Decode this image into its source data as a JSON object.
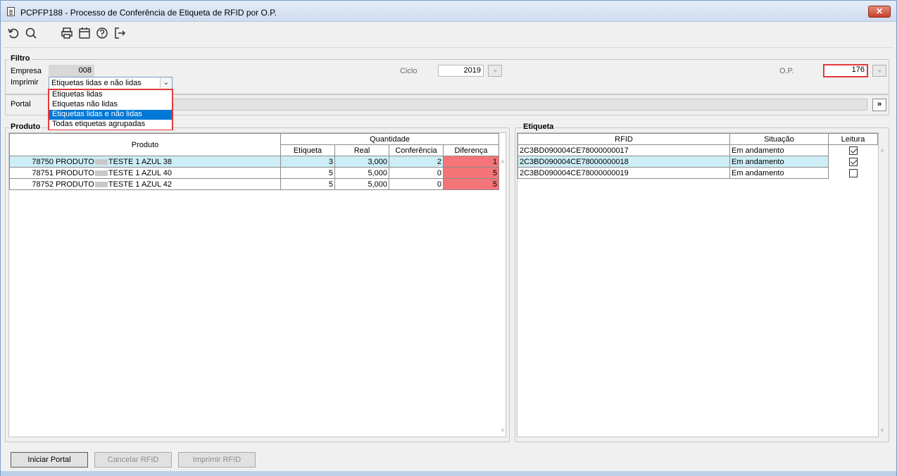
{
  "window": {
    "title": "PCPFP188 - Processo de Conferência de Etiqueta de RFID por O.P.",
    "close_label": "✕"
  },
  "toolbar": {
    "icons": [
      "undo-icon",
      "search-icon",
      "print-icon",
      "calendar-icon",
      "help-icon",
      "exit-icon"
    ]
  },
  "filter": {
    "legend": "Filtro",
    "empresa_label": "Empresa",
    "empresa_value": "008",
    "imprimir_label": "Imprimir",
    "imprimir_value": "Etiquetas lidas e não lidas",
    "ciclo_label": "Ciclo",
    "ciclo_value": "2019",
    "op_label": "O.P.",
    "op_value": "176",
    "portal_label": "Portal",
    "portal_go": "»",
    "options": [
      "Etiquetas lidas",
      "Etiquetas não lidas",
      "Etiquetas lidas e não lidas",
      "Todas etiquetas agrupadas"
    ],
    "selected_option": 2
  },
  "produto": {
    "legend": "Produto",
    "header_produto": "Produto",
    "header_quantidade": "Quantidade",
    "columns": [
      "Etiqueta",
      "Real",
      "Conferência",
      "Diferença"
    ],
    "rows": [
      {
        "code": "78750",
        "name_pre": "PRODUTO",
        "name_post": "TESTE 1 AZUL 38",
        "etiqueta": "3",
        "real": "3,000",
        "conferencia": "2",
        "diferenca": "1"
      },
      {
        "code": "78751",
        "name_pre": "PRODUTO",
        "name_post": "TESTE 1 AZUL 40",
        "etiqueta": "5",
        "real": "5,000",
        "conferencia": "0",
        "diferenca": "5"
      },
      {
        "code": "78752",
        "name_pre": "PRODUTO",
        "name_post": "TESTE 1 AZUL 42",
        "etiqueta": "5",
        "real": "5,000",
        "conferencia": "0",
        "diferenca": "5"
      }
    ]
  },
  "etiqueta": {
    "legend": "Etiqueta",
    "columns": [
      "RFID",
      "Situação",
      "Leitura"
    ],
    "rows": [
      {
        "rfid": "2C3BD090004CE78000000017",
        "situacao": "Em andamento",
        "leitura": true
      },
      {
        "rfid": "2C3BD090004CE78000000018",
        "situacao": "Em andamento",
        "leitura": true
      },
      {
        "rfid": "2C3BD090004CE78000000019",
        "situacao": "Em andamento",
        "leitura": false
      }
    ]
  },
  "buttons": {
    "iniciar": "Iniciar Portal",
    "cancelar": "Cancelar RFID",
    "imprimir": "Imprimir RFID"
  },
  "colors": {
    "highlight_red": "#f47477",
    "selection_blue": "#0078d7",
    "row_selected": "#cdeef7"
  }
}
